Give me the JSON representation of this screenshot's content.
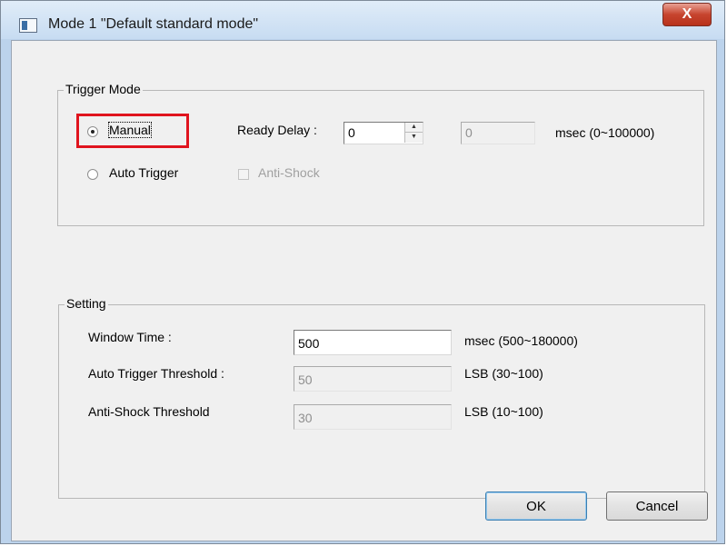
{
  "window": {
    "title": "Mode 1 \"Default standard mode\"",
    "close_label": "X"
  },
  "trigger_mode": {
    "legend": "Trigger Mode",
    "manual_label": "Manual",
    "manual_selected": true,
    "auto_trigger_label": "Auto Trigger",
    "ready_delay_label": "Ready Delay :",
    "ready_delay_value": "0",
    "ready_delay_msec_value": "0",
    "ready_delay_unit": "msec (0~100000)",
    "anti_shock_label": "Anti-Shock",
    "highlight_color": "#e0141e"
  },
  "setting": {
    "legend": "Setting",
    "rows": [
      {
        "label": "Window Time :",
        "value": "500",
        "unit": "msec (500~180000)",
        "enabled": true
      },
      {
        "label": "Auto Trigger Threshold :",
        "value": "50",
        "unit": "LSB (30~100)",
        "enabled": false
      },
      {
        "label": "Anti-Shock Threshold",
        "value": "30",
        "unit": "LSB (10~100)",
        "enabled": false
      }
    ]
  },
  "buttons": {
    "ok_label": "OK",
    "cancel_label": "Cancel"
  }
}
